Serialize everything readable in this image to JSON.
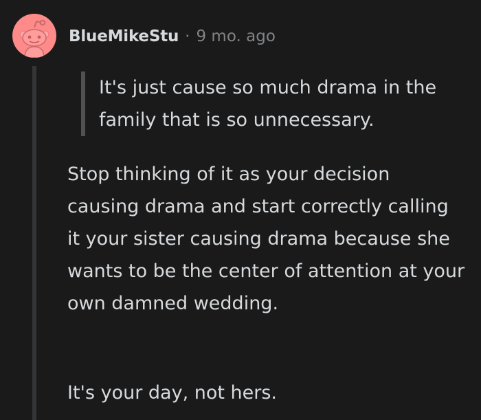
{
  "comment": {
    "author": "BlueMikeStu",
    "separator": "·",
    "timestamp": "9 mo. ago",
    "quote": "It's just cause so much drama in the family that is so unnecessary.",
    "paragraphs": [
      "Stop thinking of it as your decision causing drama and start correctly calling it your sister causing drama because she wants to be the center of attention at your own damned wedding.",
      "It's your day, not hers."
    ],
    "avatar_icon": "reddit-snoo-icon",
    "colors": {
      "background": "#1a1a1b",
      "avatar_bg": "#ff8a8a",
      "text": "#d7dadc",
      "meta": "#818384",
      "thread_line": "#343536",
      "quote_bar": "#4f5152"
    }
  }
}
